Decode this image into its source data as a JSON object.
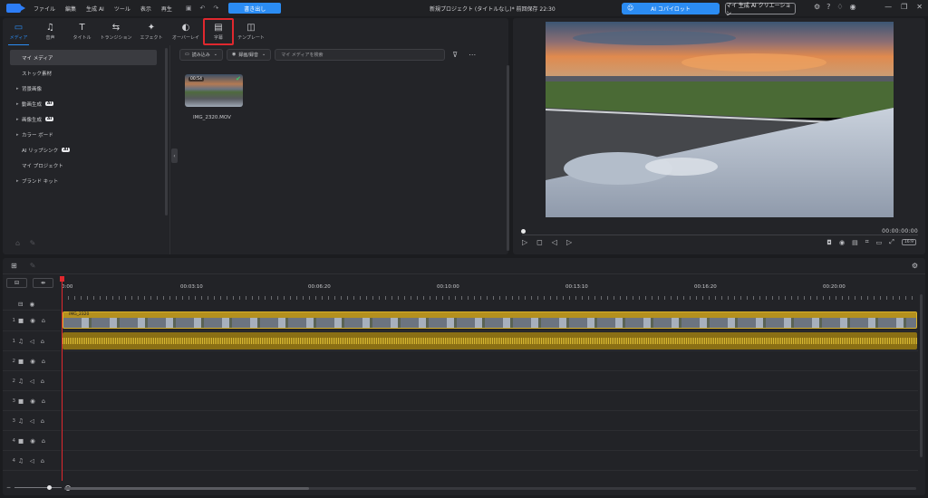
{
  "menu": [
    "ファイル",
    "編集",
    "生成 AI",
    "ツール",
    "表示",
    "再生"
  ],
  "toolbar": {
    "export_label": "書き出し"
  },
  "project_title": "新規プロジェクト (タイトルなし)* 前回保存 22:30",
  "header": {
    "copilot_label": "AI コパイロット",
    "creation_label": "マイ 生成 AI クリエーション"
  },
  "tabs": [
    {
      "id": "media",
      "label": "メディア",
      "icon": "▭"
    },
    {
      "id": "audio",
      "label": "音声",
      "icon": "♫"
    },
    {
      "id": "title",
      "label": "タイトル",
      "icon": "T"
    },
    {
      "id": "transition",
      "label": "トランジション",
      "icon": "⇆"
    },
    {
      "id": "effect",
      "label": "エフェクト",
      "icon": "✦"
    },
    {
      "id": "overlay",
      "label": "オーバーレイ",
      "icon": "◐"
    },
    {
      "id": "subtitle",
      "label": "字幕",
      "icon": "▤"
    },
    {
      "id": "template",
      "label": "テンプレート",
      "icon": "◫"
    }
  ],
  "sidebar": {
    "items": [
      {
        "label": "マイ メディア",
        "arrow": "",
        "ai": ""
      },
      {
        "label": "ストック素材",
        "arrow": "",
        "ai": ""
      },
      {
        "label": "背景画像",
        "arrow": "▸",
        "ai": ""
      },
      {
        "label": "動画生成",
        "arrow": "▸",
        "ai": "AI"
      },
      {
        "label": "画像生成",
        "arrow": "▸",
        "ai": "AI"
      },
      {
        "label": "カラー ボード",
        "arrow": "▸",
        "ai": ""
      },
      {
        "label": "AI リップシンク",
        "arrow": "",
        "ai": "AI"
      },
      {
        "label": "マイ プロジェクト",
        "arrow": "",
        "ai": ""
      },
      {
        "label": "ブランド キット",
        "arrow": "▸",
        "ai": ""
      }
    ]
  },
  "library": {
    "import_label": "読み込み",
    "record_label": "録画/録音",
    "search_placeholder": "マイ メディアを検索",
    "clip": {
      "duration": "00:54",
      "name": "IMG_2320.MOV"
    }
  },
  "preview": {
    "timecode": "00:00:00:00",
    "ratio": "16:9"
  },
  "timeline": {
    "ruler": [
      "0:00",
      "00:03:10",
      "00:06:20",
      "00:10:00",
      "00:13:10",
      "00:16:20",
      "00:20:00"
    ],
    "clip_name": "IMG_2320",
    "tracks": [
      {
        "num": "1",
        "type": "video"
      },
      {
        "num": "1",
        "type": "audio"
      },
      {
        "num": "2",
        "type": "video"
      },
      {
        "num": "2",
        "type": "audio"
      },
      {
        "num": "3",
        "type": "video"
      },
      {
        "num": "3",
        "type": "audio"
      },
      {
        "num": "4",
        "type": "video"
      },
      {
        "num": "4",
        "type": "audio"
      }
    ]
  },
  "colors": {
    "accent": "#2b8cf3",
    "highlight": "#e0282e",
    "clip": "#d9b12a"
  }
}
